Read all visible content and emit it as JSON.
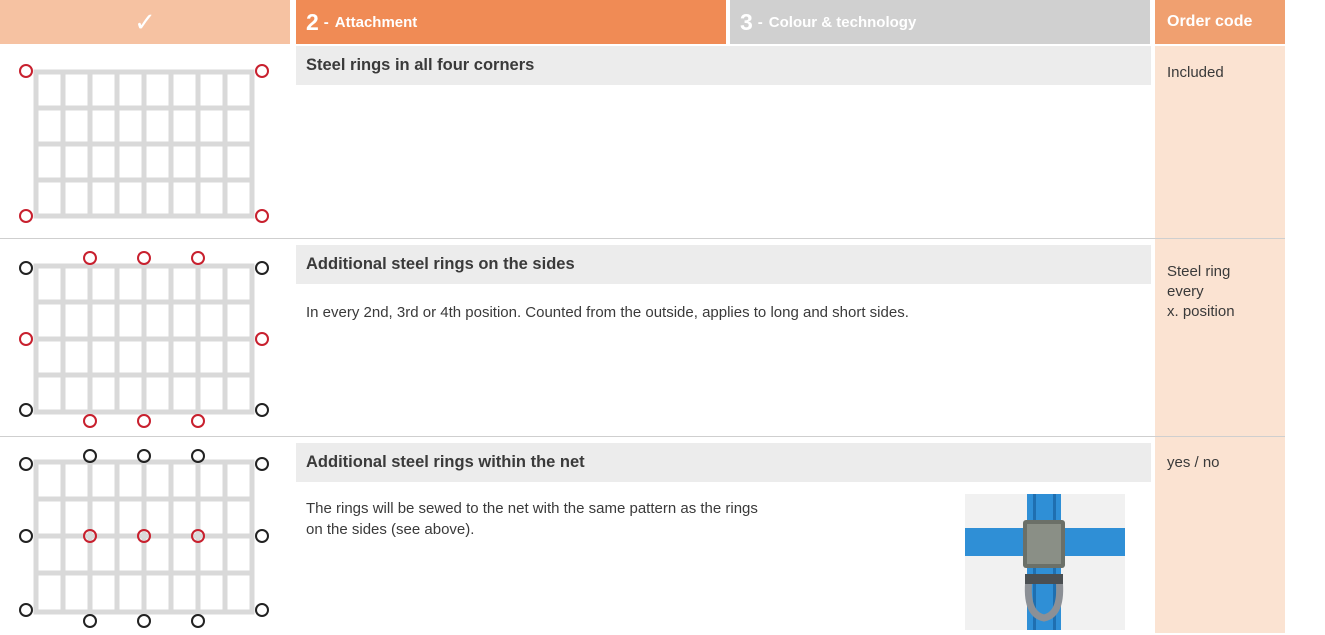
{
  "header": {
    "check": "✓",
    "step2": {
      "number": "2",
      "separator": "-",
      "label": "Attachment"
    },
    "step3": {
      "number": "3",
      "separator": "-",
      "label": "Colour & technology"
    },
    "order_code": "Order code"
  },
  "colors": {
    "accent": "#f08b55",
    "header_light": "#f6c2a2",
    "header_inactive": "#d0d0d0",
    "order_column": "#fbe3d2",
    "ring_highlight": "#c8202e",
    "ring_default": "#222222",
    "net_strap": "#d9d9d9",
    "strap_blue": "#2f8fd6"
  },
  "sections": [
    {
      "title": "Steel rings in all four corners",
      "body": [],
      "order_code": [
        "Included"
      ]
    },
    {
      "title": "Additional steel rings on the sides",
      "body": [
        "In every 2nd, 3rd or 4th position. Counted from the outside, applies to long and short sides."
      ],
      "order_code": [
        "Steel ring",
        "every",
        "x. position"
      ]
    },
    {
      "title": "Additional steel rings within the net",
      "body": [
        "The rings will be sewed to the net with the same pattern as the rings",
        "on the sides (see above)."
      ],
      "order_code": [
        "yes / no"
      ]
    }
  ],
  "photo": {
    "icon": "strap-with-d-ring-photo"
  }
}
